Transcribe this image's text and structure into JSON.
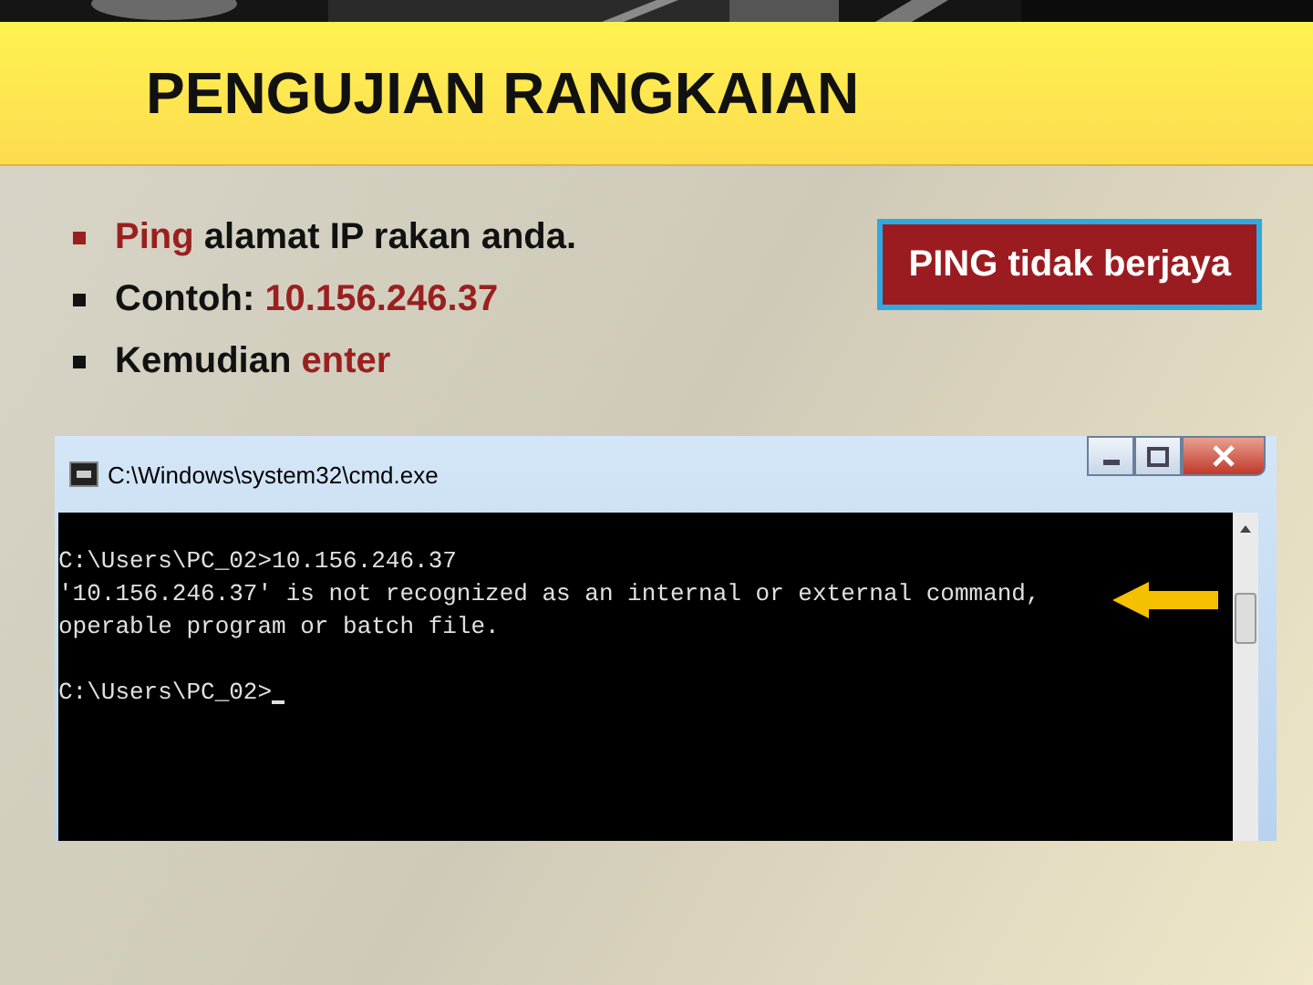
{
  "slide_title": "PENGUJIAN RANGKAIAN",
  "bullets": [
    [
      {
        "text": "Ping",
        "emphasis": true
      },
      {
        "text": " alamat IP rakan anda.",
        "emphasis": false
      }
    ],
    [
      {
        "text": "Contoh: ",
        "emphasis": false
      },
      {
        "text": "10.156.246.37",
        "emphasis": true
      }
    ],
    [
      {
        "text": "Kemudian ",
        "emphasis": false
      },
      {
        "text": "enter",
        "emphasis": true
      }
    ]
  ],
  "callout": "PING tidak berjaya",
  "console_window": {
    "title": "C:\\Windows\\system32\\cmd.exe",
    "blocks": [
      [
        "C:\\Users\\PC_02>10.156.246.37",
        "'10.156.246.37' is not recognized as an internal or external command,",
        "operable program or batch file."
      ],
      [
        "C:\\Users\\PC_02>"
      ]
    ]
  }
}
